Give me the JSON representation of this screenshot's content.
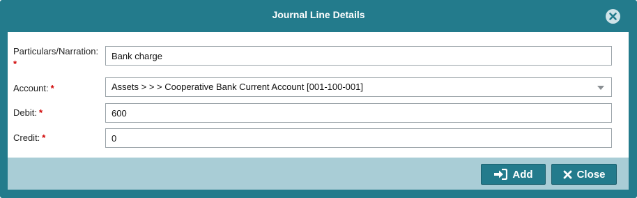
{
  "dialog": {
    "title": "Journal Line Details"
  },
  "form": {
    "particulars": {
      "label": "Particulars/Narration:",
      "required_mark": "*",
      "value": "Bank charge"
    },
    "account": {
      "label": "Account:",
      "required_mark": "*",
      "value": "Assets >  >  > Cooperative Bank Current Account [001-100-001]"
    },
    "debit": {
      "label": "Debit:",
      "required_mark": "*",
      "value": "600"
    },
    "credit": {
      "label": "Credit:",
      "required_mark": "*",
      "value": "0"
    }
  },
  "footer": {
    "add_label": "Add",
    "close_label": "Close"
  },
  "icons": {
    "title_close": "close-circle-icon",
    "add": "sign-in-icon",
    "close": "x-icon"
  },
  "colors": {
    "primary": "#237b8c",
    "footer_bg": "#a9cdd6",
    "required": "#d00000"
  }
}
